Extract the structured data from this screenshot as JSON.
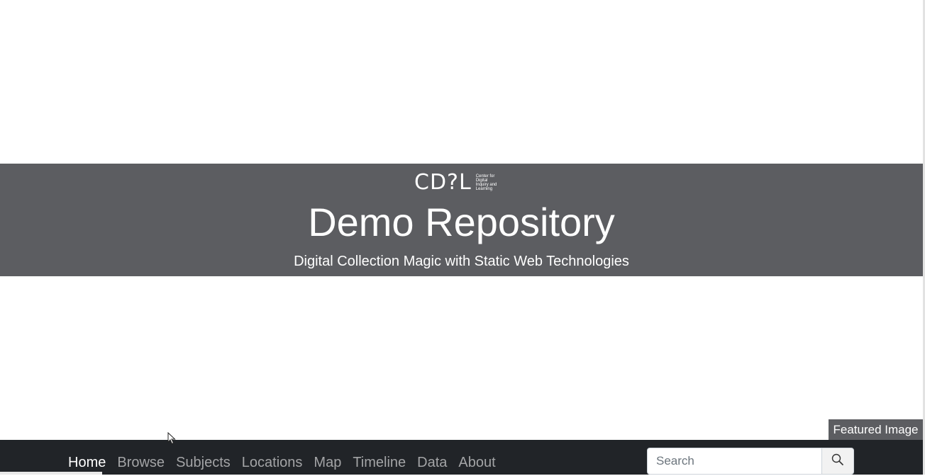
{
  "hero": {
    "logo_mark": "CD?L",
    "logo_subtext": "Center for Digital Inquiry and Learning",
    "title": "Demo Repository",
    "subtitle": "Digital Collection Magic with Static Web Technologies"
  },
  "featured": {
    "label": "Featured Image"
  },
  "nav": {
    "items": [
      {
        "label": "Home",
        "active": true
      },
      {
        "label": "Browse"
      },
      {
        "label": "Subjects"
      },
      {
        "label": "Locations"
      },
      {
        "label": "Map"
      },
      {
        "label": "Timeline"
      },
      {
        "label": "Data"
      },
      {
        "label": "About"
      }
    ]
  },
  "search": {
    "placeholder": "Search",
    "button_icon": "search-icon"
  },
  "colors": {
    "hero_bg": "#5c5d61",
    "navbar_bg": "#212428",
    "nav_link": "#a3a4a6",
    "nav_link_active": "#ffffff"
  }
}
